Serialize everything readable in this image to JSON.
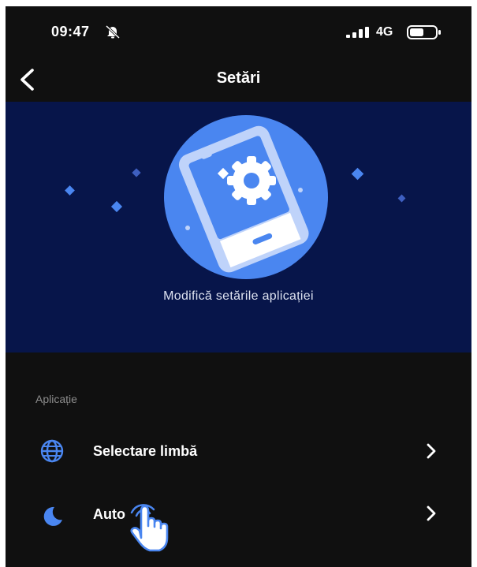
{
  "status_bar": {
    "time": "09:47",
    "network": "4G",
    "icons": [
      "bell-slash-icon",
      "signal-bars-icon",
      "battery-icon"
    ]
  },
  "header": {
    "title": "Setări",
    "back_icon": "chevron-left-icon"
  },
  "hero": {
    "caption": "Modifică setările aplicației",
    "illustration": "phone-gear-illustration"
  },
  "settings": {
    "section_label": "Aplicație",
    "items": [
      {
        "label": "Selectare limbă",
        "icon": "globe-icon"
      },
      {
        "label": "Auto",
        "icon": "moon-icon"
      }
    ]
  },
  "overlay": {
    "icon": "pointing-hand-icon"
  },
  "colors": {
    "background": "#101010",
    "hero_background": "#07154a",
    "accent": "#4a86f0",
    "text": "#ffffff",
    "section_label": "#8d8d8d"
  }
}
